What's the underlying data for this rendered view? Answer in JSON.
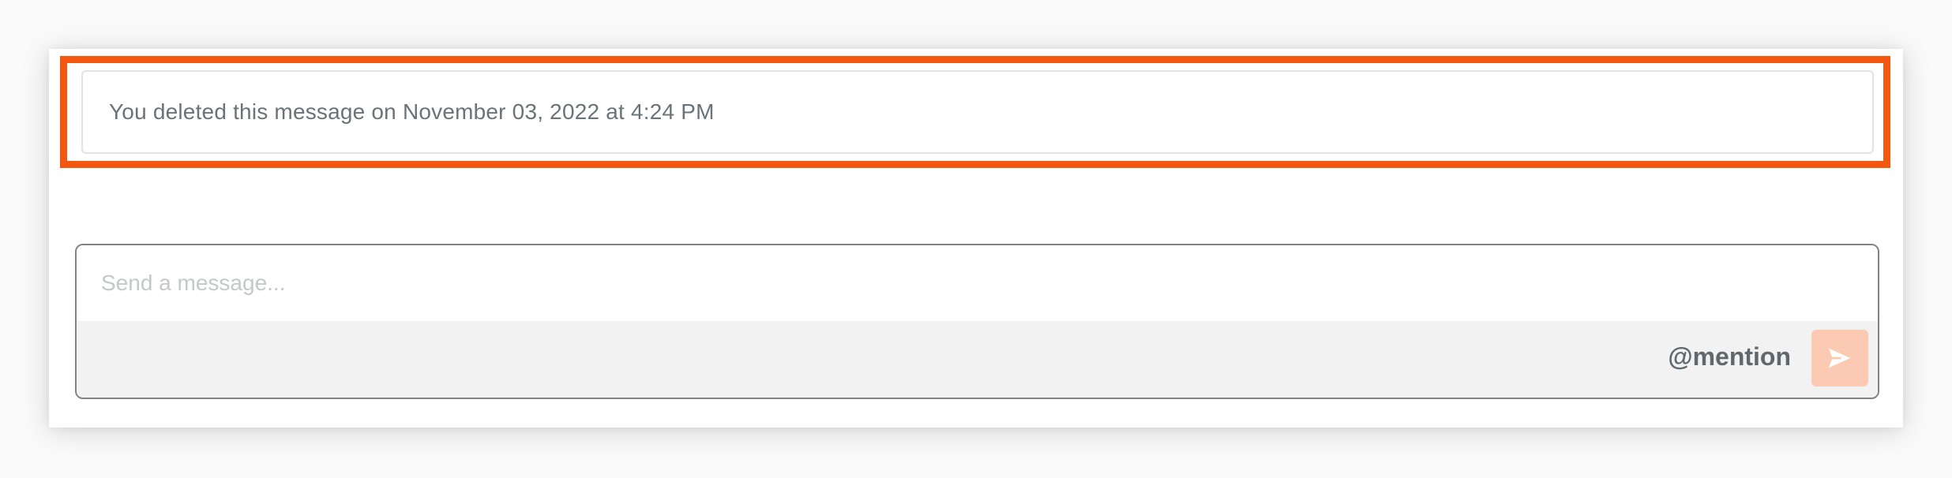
{
  "message": {
    "deleted_text": "You deleted this message on November 03, 2022 at 4:24 PM"
  },
  "composer": {
    "placeholder": "Send a message...",
    "value": "",
    "mention_label": "@mention",
    "send_icon": "send-icon"
  },
  "colors": {
    "highlight": "#f4570f",
    "send_button": "#fcc9b3"
  }
}
